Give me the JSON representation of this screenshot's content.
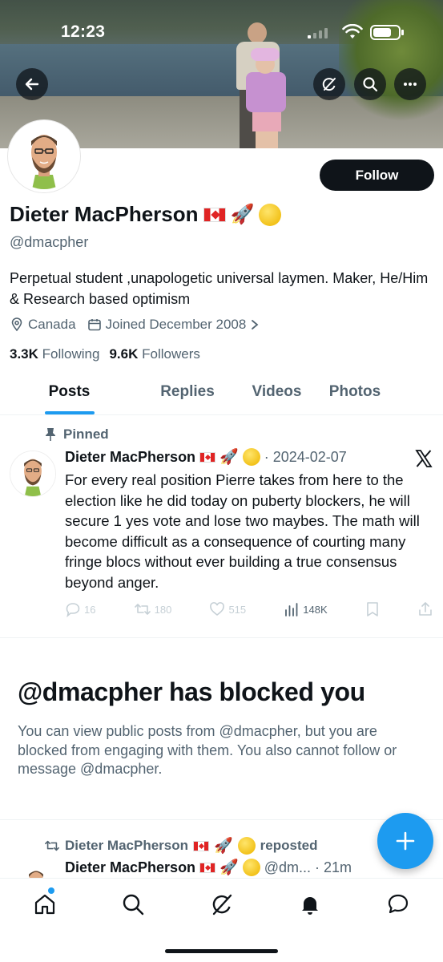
{
  "status_bar": {
    "time": "12:23"
  },
  "profile": {
    "name": "Dieter MacPherson",
    "handle": "@dmacpher",
    "bio": "Perpetual student ,unapologetic universal laymen. Maker, He/Him & Research based optimism",
    "location": "Canada",
    "joined": "Joined December 2008",
    "following_count": "3.3K",
    "following_label": "Following",
    "followers_count": "9.6K",
    "followers_label": "Followers",
    "follow_button": "Follow"
  },
  "tabs": [
    {
      "label": "Posts",
      "active": true
    },
    {
      "label": "Replies",
      "active": false
    },
    {
      "label": "Videos",
      "active": false
    },
    {
      "label": "Photos",
      "active": false
    }
  ],
  "pinned_post": {
    "pinned_label": "Pinned",
    "author": "Dieter MacPherson",
    "date": "· 2024-02-07",
    "text": "For every real position Pierre takes from here to the election like he did today on puberty blockers, he will secure 1 yes vote and lose two maybes. The math will become difficult as a consequence of courting many fringe blocs without ever building a true consensus beyond anger.",
    "replies": "16",
    "reposts": "180",
    "likes": "515",
    "views": "148K"
  },
  "blocked": {
    "title": "@dmacpher has blocked you",
    "description": "You can view public posts from @dmacpher, but you are blocked from engaging with them. You also cannot follow or message @dmacpher."
  },
  "repost": {
    "reposter": "Dieter MacPherson",
    "reposted_label": "reposted",
    "author": "Dieter MacPherson",
    "handle_trunc": "@dm...",
    "time": "· 21m"
  },
  "colors": {
    "accent": "#1d9bf0",
    "text": "#0f1419",
    "muted": "#536471"
  },
  "icons": {
    "back": "arrow-left-icon",
    "grok": "grok-icon",
    "search": "search-icon",
    "more": "more-horizontal-icon",
    "location": "location-pin-icon",
    "calendar": "calendar-icon",
    "pin": "pin-icon",
    "x": "x-logo-icon",
    "compose": "plus-icon"
  }
}
